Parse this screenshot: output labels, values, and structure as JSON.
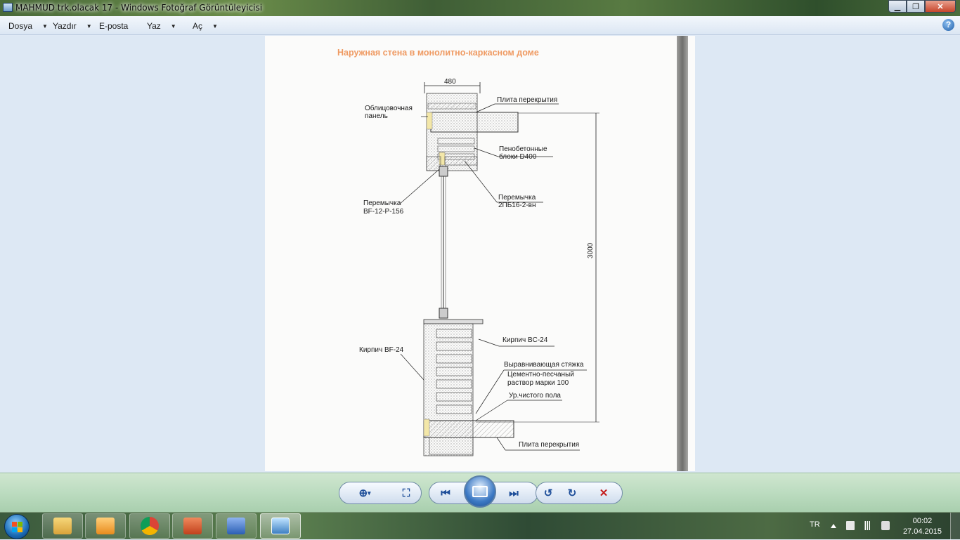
{
  "window": {
    "title": "MAHMUD trk.olacak 17 - Windows Fotoğraf Görüntüleyicisi",
    "min_glyph": "▁",
    "max_glyph": "❐",
    "close_glyph": "✕"
  },
  "menu": {
    "items": [
      {
        "label": "Dosya",
        "caret": "▼"
      },
      {
        "label": "Yazdır",
        "caret": "▼"
      },
      {
        "label": "E-posta"
      },
      {
        "label": "Yaz",
        "caret": "▼"
      },
      {
        "label": "Aç",
        "caret": "▼"
      }
    ],
    "help_glyph": "?"
  },
  "document": {
    "title": "Наружная стена в монолитно-каркасном доме",
    "dimension_top": "480",
    "dimension_height": "3000",
    "labels": {
      "oblic_1": "Облицовочная",
      "oblic_2": "панель",
      "plita_top": "Плита перекрытия",
      "penobeton_1": "Пенобетонные",
      "penobeton_2": "блоки D400",
      "peremychka_r1": "Перемычка",
      "peremychka_r2": "2ПБ16-2-вн",
      "peremychka_l1": "Перемычка",
      "peremychka_l2": "BF-12-P-156",
      "kirpich_bf": "Кирпич BF-24",
      "kirpich_bc": "Кирпич BC-24",
      "styazhka": "Выравнивающая стяжка",
      "rastvor_1": "Цементно-песчаный",
      "rastvor_2": "раствор марки 100",
      "pol": "Ур.чистого пола",
      "plita_bottom": "Плита перекрытия"
    }
  },
  "controls": {
    "zoom_glyph": "⊕",
    "zoom_caret": "▾",
    "fit_glyph": "⛶",
    "prev_glyph": "⏮",
    "next_glyph": "⏭",
    "rotate_ccw_glyph": "↺",
    "rotate_cw_glyph": "↻",
    "delete_glyph": "✕"
  },
  "taskbar": {
    "language": "TR",
    "time": "00:02",
    "date": "27.04.2015",
    "apps": [
      "explorer",
      "media-player",
      "chrome",
      "powerpoint",
      "word",
      "photo-viewer"
    ]
  }
}
